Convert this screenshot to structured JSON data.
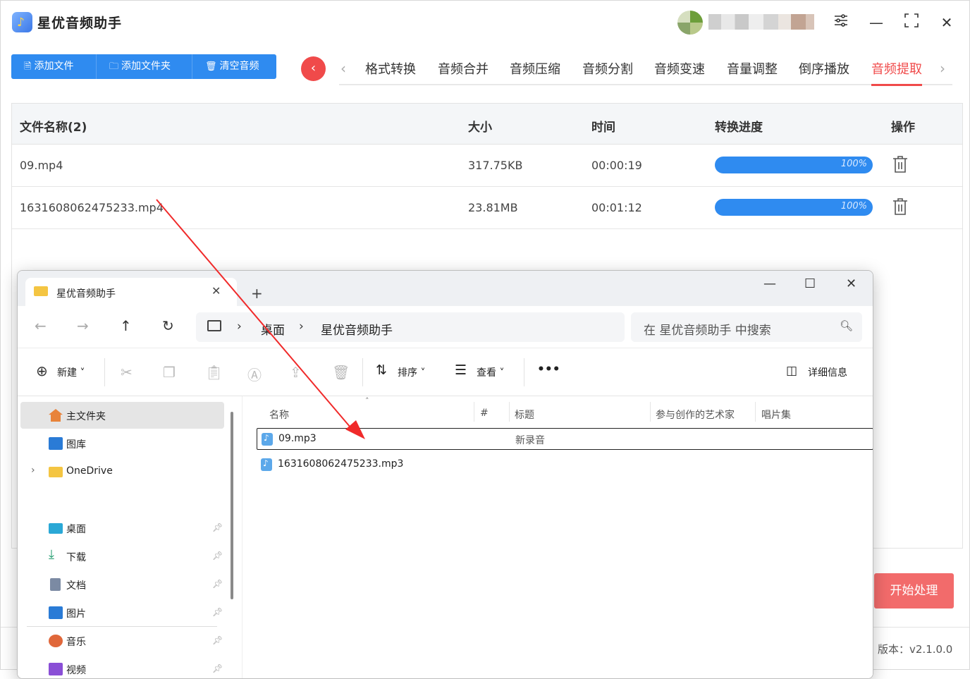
{
  "app": {
    "title": "星优音频助手",
    "logo_icon": "music-note-icon",
    "toolbar": [
      {
        "label": "添加文件",
        "icon": "file-icon"
      },
      {
        "label": "添加文件夹",
        "icon": "folder-icon"
      },
      {
        "label": "清空音频",
        "icon": "trash-icon"
      }
    ],
    "tabs": [
      "格式转换",
      "音频合并",
      "音频压缩",
      "音频分割",
      "音频变速",
      "音量调整",
      "倒序播放",
      "音频提取"
    ],
    "active_tab": "音频提取",
    "accent_color": "#f04a4a",
    "primary_color": "#2f8bf0",
    "table": {
      "headers": {
        "name": "文件名称(2)",
        "size": "大小",
        "time": "时间",
        "progress": "转换进度",
        "action": "操作"
      },
      "rows": [
        {
          "name": "09.mp4",
          "size": "317.75KB",
          "time": "00:00:19",
          "progress_label": "100%",
          "progress": 1.0
        },
        {
          "name": "1631608062475233.mp4",
          "size": "23.81MB",
          "time": "00:01:12",
          "progress_label": "100%",
          "progress": 1.0
        }
      ]
    },
    "start_button": "开始处理",
    "version": "版本：v2.1.0.0"
  },
  "explorer": {
    "tab_title": "星优音频助手",
    "breadcrumb": [
      "桌面",
      "星优音频助手"
    ],
    "search_placeholder": "在 星优音频助手 中搜索",
    "commands": {
      "new": "新建",
      "sort": "排序",
      "view": "查看",
      "more": "•••",
      "details": "详细信息"
    },
    "nav": [
      {
        "label": "主文件夹",
        "icon": "home-icon",
        "color": "#e8833a"
      },
      {
        "label": "图库",
        "icon": "gallery-icon",
        "color": "#2a7bd6"
      },
      {
        "label": "OneDrive",
        "icon": "folder-icon",
        "color": "#f4c542"
      },
      {
        "label": "桌面",
        "icon": "desktop-icon",
        "color": "#2aa8d6"
      },
      {
        "label": "下载",
        "icon": "download-icon",
        "color": "#1c9a6b"
      },
      {
        "label": "文档",
        "icon": "document-icon",
        "color": "#7b8aa3"
      },
      {
        "label": "图片",
        "icon": "pictures-icon",
        "color": "#2a7bd6"
      },
      {
        "label": "音乐",
        "icon": "music-icon",
        "color": "#e0673a"
      },
      {
        "label": "视频",
        "icon": "video-icon",
        "color": "#8a4fd6"
      }
    ],
    "columns": [
      "名称",
      "#",
      "标题",
      "参与创作的艺术家",
      "唱片集"
    ],
    "files": [
      {
        "name": "09.mp3",
        "title": "新录音"
      },
      {
        "name": "1631608062475233.mp3",
        "title": ""
      }
    ]
  }
}
